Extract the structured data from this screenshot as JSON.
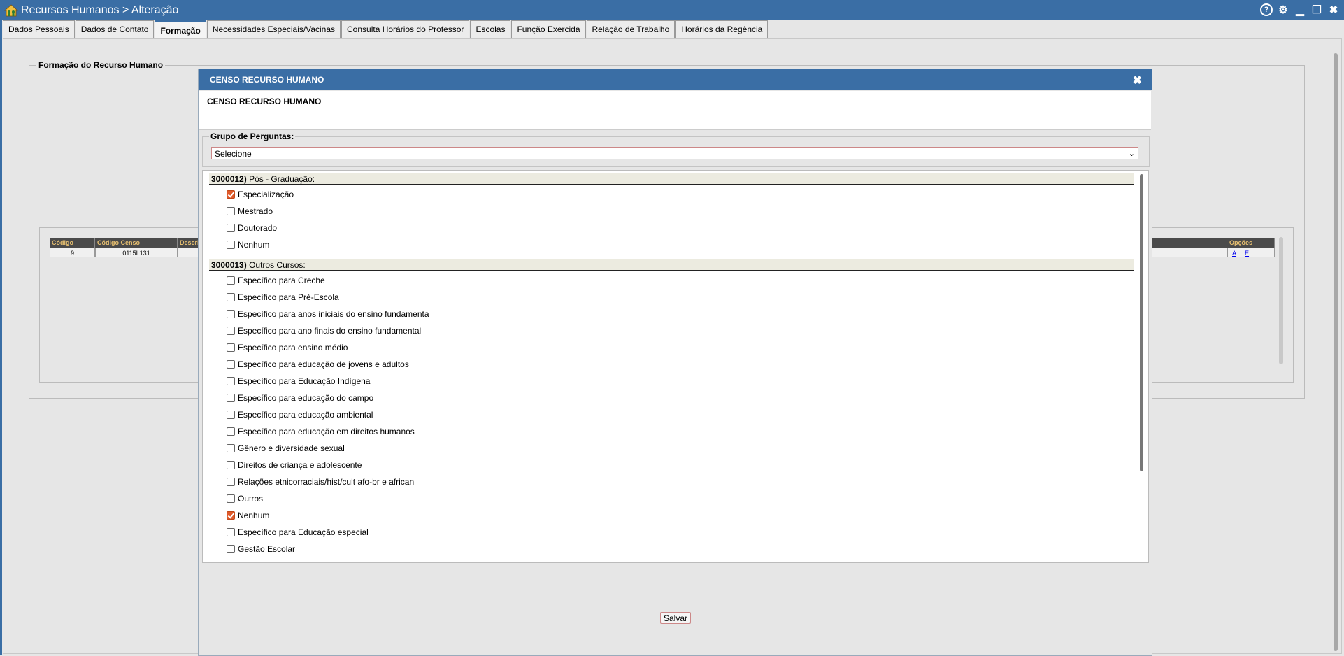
{
  "window": {
    "title": "Recursos Humanos > Alteração"
  },
  "tabs": [
    {
      "label": "Dados Pessoais"
    },
    {
      "label": "Dados de Contato"
    },
    {
      "label": "Formação"
    },
    {
      "label": "Necessidades Especiais/Vacinas"
    },
    {
      "label": "Consulta Horários do Professor"
    },
    {
      "label": "Escolas"
    },
    {
      "label": "Função Exercida"
    },
    {
      "label": "Relação de Trabalho"
    },
    {
      "label": "Horários da Regência"
    }
  ],
  "active_tab": "Formação",
  "formacao": {
    "legend": "Formação do Recurso Humano",
    "table": {
      "headers": [
        "Código",
        "Código Censo",
        "Descri",
        "Opções"
      ],
      "row": {
        "codigo": "9",
        "codigo_censo": "0115L131",
        "link_a": "A",
        "link_e": "E"
      }
    }
  },
  "modal": {
    "title": "CENSO RECURSO HUMANO",
    "subtitle": "CENSO RECURSO HUMANO",
    "group_legend": "Grupo de Perguntas:",
    "group_select": "Selecione",
    "questions": [
      {
        "code": "3000012)",
        "label": "Pós - Graduação:",
        "options": [
          {
            "label": "Especialização",
            "checked": true
          },
          {
            "label": "Mestrado",
            "checked": false
          },
          {
            "label": "Doutorado",
            "checked": false
          },
          {
            "label": "Nenhum",
            "checked": false
          }
        ]
      },
      {
        "code": "3000013)",
        "label": "Outros Cursos:",
        "options": [
          {
            "label": "Específico para Creche",
            "checked": false
          },
          {
            "label": "Específico para Pré-Escola",
            "checked": false
          },
          {
            "label": "Específico para anos iniciais do ensino fundamenta",
            "checked": false
          },
          {
            "label": "Específico para ano finais do ensino fundamental",
            "checked": false
          },
          {
            "label": "Específico para ensino médio",
            "checked": false
          },
          {
            "label": "Específico para educação de jovens e adultos",
            "checked": false
          },
          {
            "label": "Específico para Educação Indígena",
            "checked": false
          },
          {
            "label": "Específico para educação do campo",
            "checked": false
          },
          {
            "label": "Específico para educação ambiental",
            "checked": false
          },
          {
            "label": "Específico para educação em direitos humanos",
            "checked": false
          },
          {
            "label": "Gênero e diversidade sexual",
            "checked": false
          },
          {
            "label": "Direitos de criança e adolescente",
            "checked": false
          },
          {
            "label": "Relações etnicorraciais/hist/cult afo-br e african",
            "checked": false
          },
          {
            "label": "Outros",
            "checked": false
          },
          {
            "label": "Nenhum",
            "checked": true
          },
          {
            "label": "Específico para Educação especial",
            "checked": false
          },
          {
            "label": "Gestão Escolar",
            "checked": false
          }
        ]
      }
    ],
    "save_label": "Salvar"
  },
  "icons": {
    "app": "home-people-icon",
    "help": "help-icon",
    "settings": "gear-icon",
    "minimize": "minimize-icon",
    "restore": "restore-icon",
    "close": "close-icon"
  },
  "colors": {
    "titlebar": "#3a6ea5",
    "checkbox_checked": "#e05a2b",
    "table_header": "#4a4a4a"
  }
}
